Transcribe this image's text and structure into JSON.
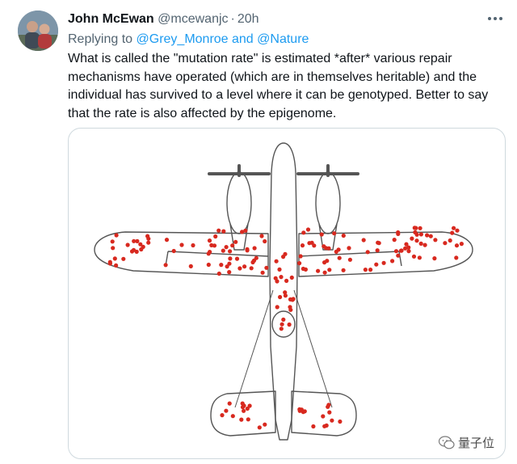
{
  "tweet": {
    "author_name": "John McEwan",
    "handle": "@mcewanjc",
    "separator": "·",
    "time_ago": "20h",
    "reply_prefix": "Replying to",
    "reply_mentions": "@Grey_Monroe and @Nature",
    "text_lines": [
      "What is called the \"mutation rate\" is estimated *after* various repair",
      "mechanisms have operated (which are in themselves heritable) and the",
      "individual has survived to a level where it can be genotyped. Better to say",
      "that the rate is also affected by the epigenome."
    ],
    "more_icon": "more-horizontal-icon"
  },
  "media": {
    "subject": "plane-damage-diagram",
    "outline_color": "#555555",
    "hit_color": "#d8291f"
  },
  "watermark": {
    "text": "量子位",
    "icon": "wechat-icon"
  },
  "colors": {
    "link": "#1d9bf0",
    "secondary_text": "#536471",
    "primary_text": "#0f1419",
    "border": "#cfd9de"
  }
}
